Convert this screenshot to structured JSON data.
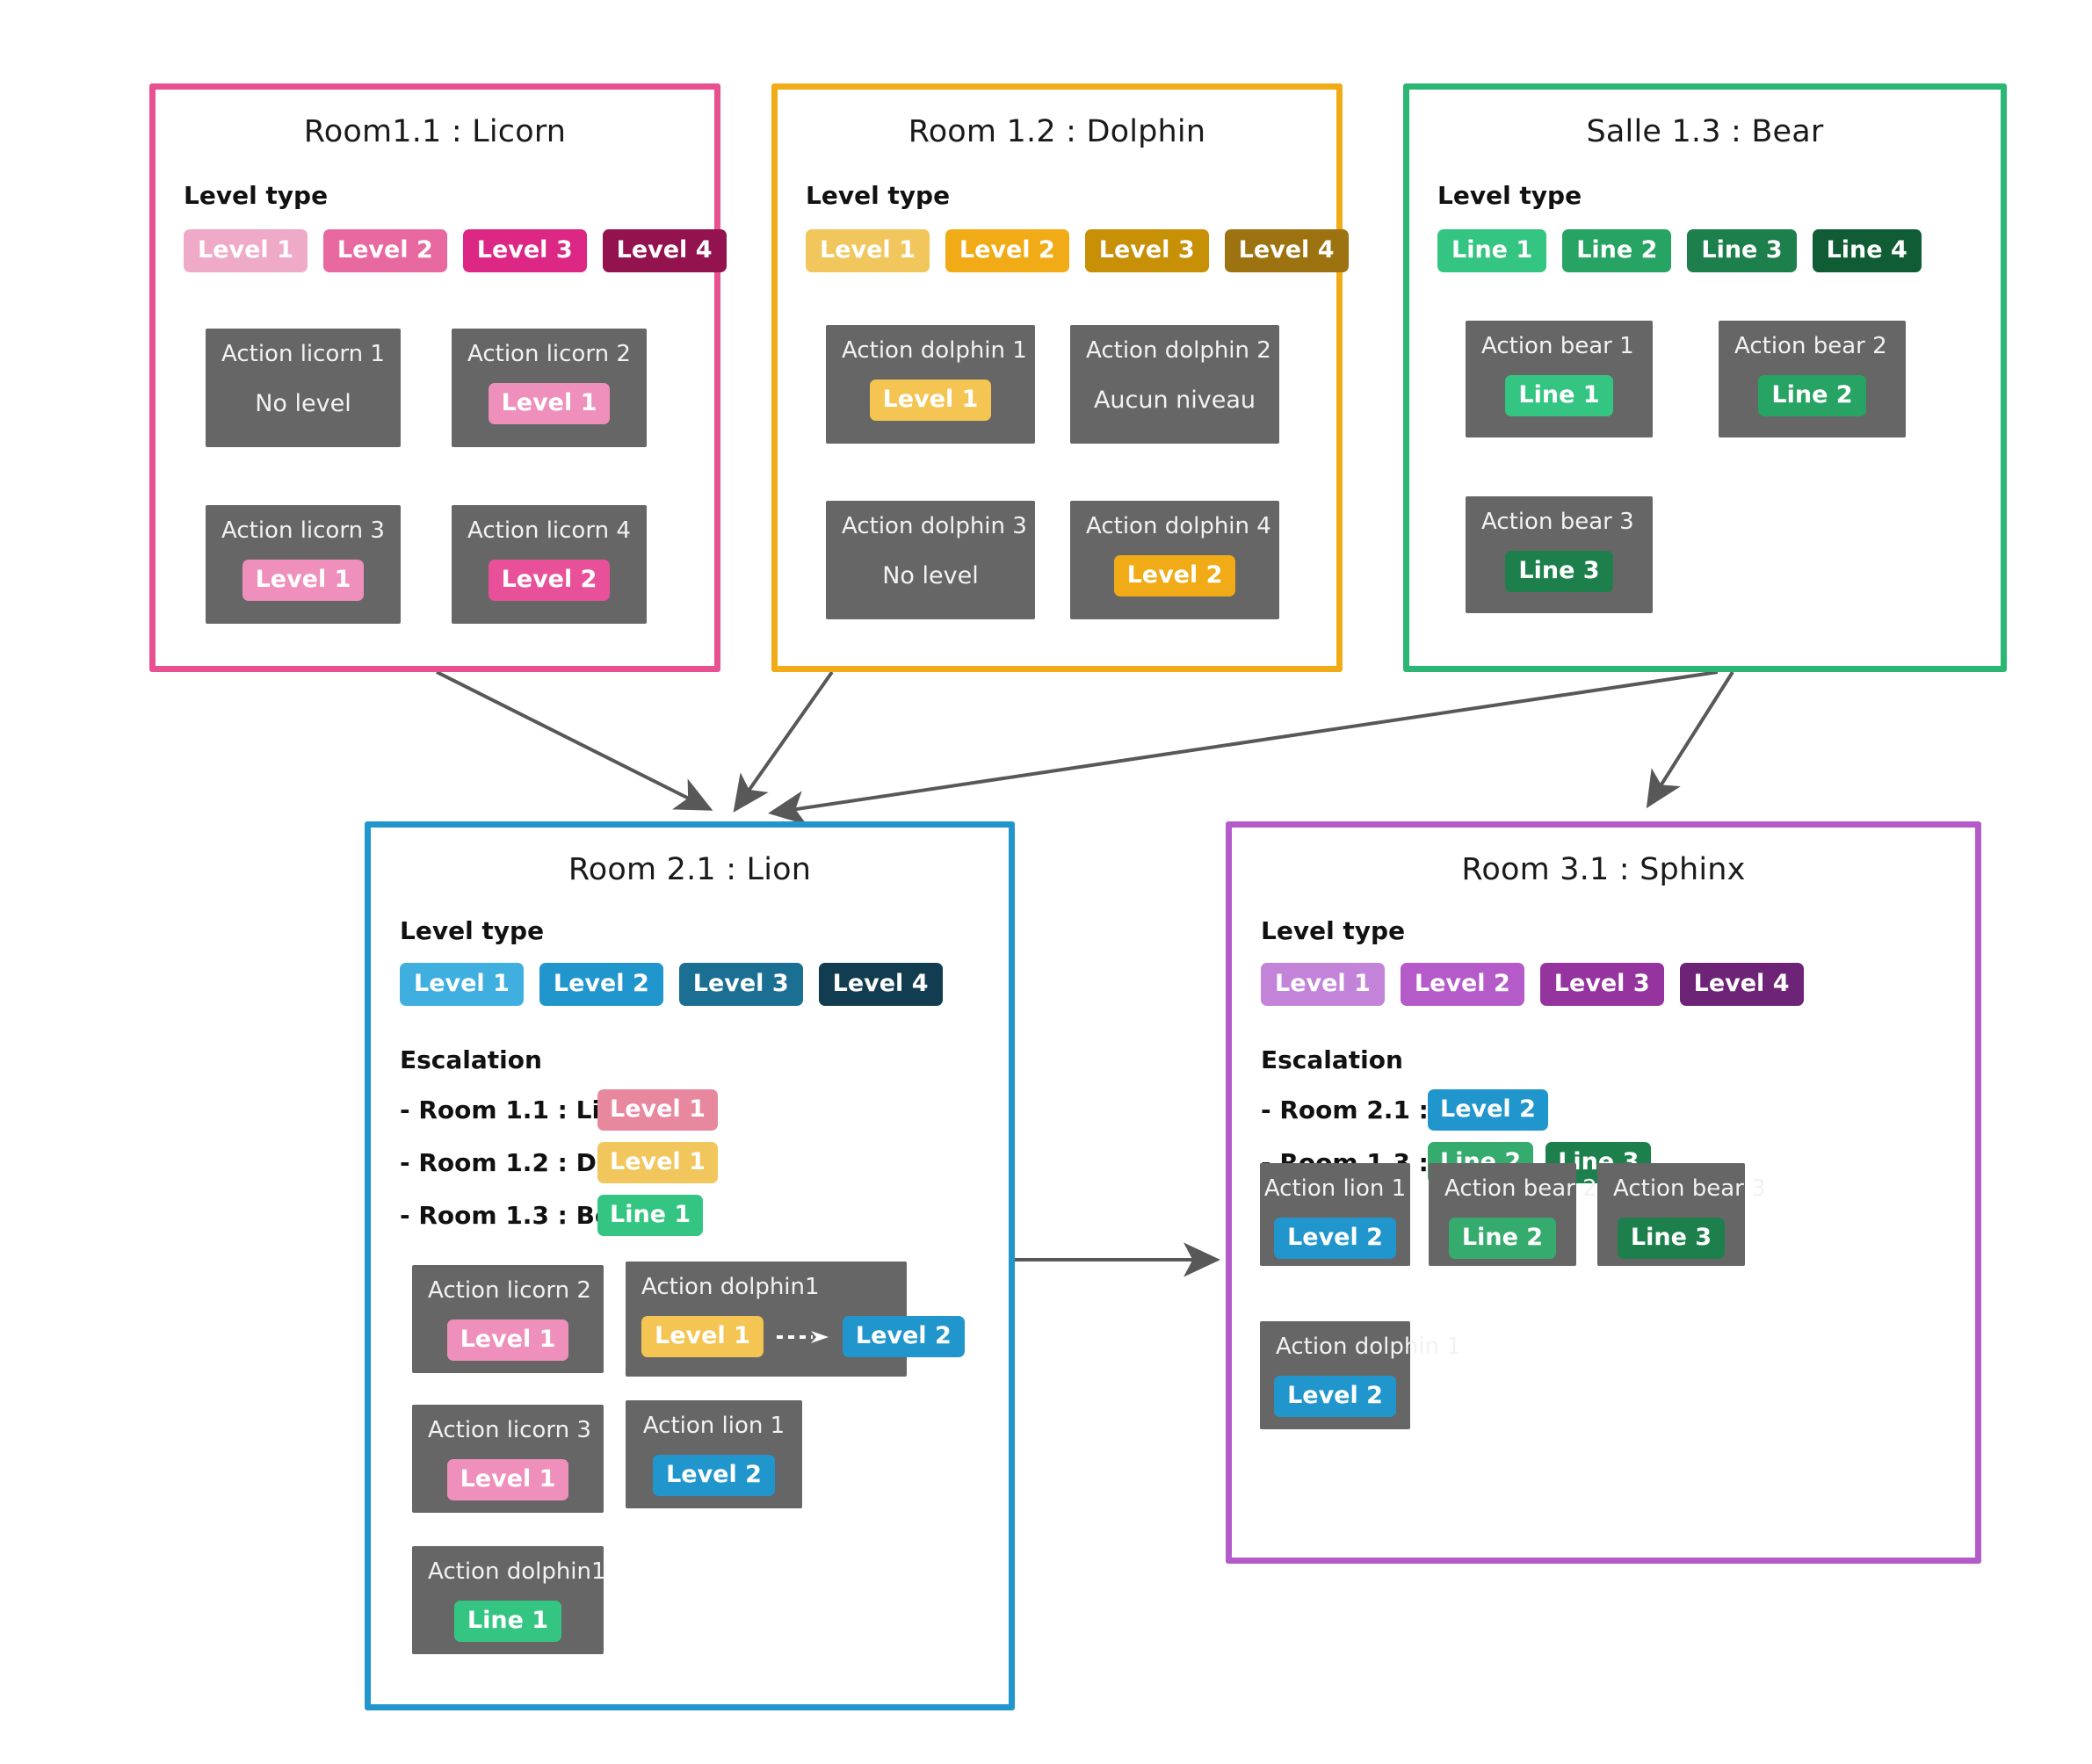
{
  "diagram": {
    "section_labels": {
      "level_type": "Level type",
      "escalation": "Escalation"
    },
    "no_level_en": "No level",
    "no_level_fr": "Aucun niveau"
  },
  "colors": {
    "licorn_border": "#e8518f",
    "dolphin_border": "#f0ab16",
    "bear_border": "#2bb673",
    "lion_border": "#2196cd",
    "sphinx_border": "#b45bc9",
    "action_bg": "#666666",
    "arrow": "#585858",
    "pink_1": "#eeaac6",
    "pink_2": "#e8699f",
    "pink_3": "#dc2784",
    "pink_4": "#93134f",
    "pink_escal": "#e8889f",
    "pink_action": "#ef8fbb",
    "amber_1": "#f1c65c",
    "amber_2": "#f0ab16",
    "amber_3": "#c79007",
    "amber_4": "#9c7310",
    "green_1": "#35c583",
    "green_2": "#27a463",
    "green_3": "#1d804c",
    "green_4": "#0f5c35",
    "blue_1": "#3fafdf",
    "blue_2": "#2196cd",
    "blue_3": "#1a6f92",
    "blue_4": "#123c50",
    "purple_1": "#c383d9",
    "purple_2": "#b45bc9",
    "purple_3": "#95349f",
    "purple_4": "#6d2476"
  },
  "rooms": {
    "licorn": {
      "title": "Room1.1 : Licorn",
      "level_type": [
        {
          "label": "Level 1",
          "color": "#eeaac6"
        },
        {
          "label": "Level 2",
          "color": "#e8699f"
        },
        {
          "label": "Level 3",
          "color": "#dc2784"
        },
        {
          "label": "Level 4",
          "color": "#93134f"
        }
      ],
      "actions": [
        {
          "title": "Action licorn  1",
          "no_level": "No level",
          "badge": null
        },
        {
          "title": "Action licorn 2",
          "badge": {
            "label": "Level 1",
            "color": "#ef8fbb"
          }
        },
        {
          "title": "Action licorn 3",
          "badge": {
            "label": "Level 1",
            "color": "#ef8fbb"
          }
        },
        {
          "title": "Action licorn 4",
          "badge": {
            "label": "Level 2",
            "color": "#e8519a"
          }
        }
      ]
    },
    "dolphin": {
      "title": "Room 1.2 : Dolphin",
      "level_type": [
        {
          "label": "Level 1",
          "color": "#f1c65c"
        },
        {
          "label": "Level 2",
          "color": "#f0ab16"
        },
        {
          "label": "Level 3",
          "color": "#c79007"
        },
        {
          "label": "Level 4",
          "color": "#9c7310"
        }
      ],
      "actions": [
        {
          "title": "Action dolphin 1",
          "badge": {
            "label": "Level 1",
            "color": "#f4c552"
          }
        },
        {
          "title": "Action dolphin 2",
          "no_level": "Aucun niveau",
          "badge": null
        },
        {
          "title": "Action dolphin 3",
          "no_level": "No level",
          "badge": null
        },
        {
          "title": "Action dolphin 4",
          "badge": {
            "label": "Level 2",
            "color": "#f0ab16"
          }
        }
      ]
    },
    "bear": {
      "title": "Salle 1.3 : Bear",
      "level_type": [
        {
          "label": "Line 1",
          "color": "#35c583"
        },
        {
          "label": "Line 2",
          "color": "#27a463"
        },
        {
          "label": "Line 3",
          "color": "#1d804c"
        },
        {
          "label": "Line 4",
          "color": "#0f5c35"
        }
      ],
      "actions": [
        {
          "title": "Action bear 1",
          "badge": {
            "label": "Line 1",
            "color": "#35c583"
          }
        },
        {
          "title": "Action bear 2",
          "badge": {
            "label": "Line 2",
            "color": "#27a463"
          }
        },
        {
          "title": "Action bear 3",
          "badge": {
            "label": "Line 3",
            "color": "#1d804c"
          }
        }
      ]
    },
    "lion": {
      "title": "Room 2.1 : Lion",
      "level_type": [
        {
          "label": "Level 1",
          "color": "#3fafdf"
        },
        {
          "label": "Level 2",
          "color": "#2196cd"
        },
        {
          "label": "Level 3",
          "color": "#1a6f92"
        },
        {
          "label": "Level 4",
          "color": "#123c50"
        }
      ],
      "escalation": [
        {
          "label": "- Room 1.1 : Licorn",
          "badges": [
            {
              "label": "Level 1",
              "color": "#e8889f"
            }
          ]
        },
        {
          "label": "- Room 1.2 : Dolphin",
          "badges": [
            {
              "label": "Level 1",
              "color": "#f1c65c"
            }
          ]
        },
        {
          "label": "- Room 1.3 : Bear",
          "badges": [
            {
              "label": "Line 1",
              "color": "#35c583"
            }
          ]
        }
      ],
      "actions": [
        {
          "title": "Action licorn 2",
          "badge": {
            "label": "Level 1",
            "color": "#ef8fbb"
          }
        },
        {
          "title": "Action dolphin1",
          "badge": {
            "label": "Level 1",
            "color": "#f4c552"
          },
          "badge2": {
            "label": "Level 2",
            "color": "#2196cd"
          }
        },
        {
          "title": "Action licorn 3",
          "badge": {
            "label": "Level 1",
            "color": "#ef8fbb"
          }
        },
        {
          "title": "Action lion 1",
          "badge": {
            "label": "Level 2",
            "color": "#2196cd"
          }
        },
        {
          "title": "Action dolphin1",
          "badge": {
            "label": "Line 1",
            "color": "#35c583"
          }
        }
      ]
    },
    "sphinx": {
      "title": "Room 3.1 : Sphinx",
      "level_type": [
        {
          "label": "Level 1",
          "color": "#c383d9"
        },
        {
          "label": "Level 2",
          "color": "#b45bc9"
        },
        {
          "label": "Level 3",
          "color": "#95349f"
        },
        {
          "label": "Level 4",
          "color": "#6d2476"
        }
      ],
      "escalation": [
        {
          "label": "- Room 2.1 : Lion",
          "badges": [
            {
              "label": "Level 2",
              "color": "#2196cd"
            }
          ]
        },
        {
          "label": "- Room 1.3 : Bear",
          "badges": [
            {
              "label": "Line 2",
              "color": "#35ab6d"
            },
            {
              "label": "Line 3",
              "color": "#1d804c"
            }
          ]
        }
      ],
      "actions": [
        {
          "title": "Action lion 1",
          "badge": {
            "label": "Level 2",
            "color": "#2196cd"
          }
        },
        {
          "title": "Action bear 2",
          "badge": {
            "label": "Line 2",
            "color": "#35ab6d"
          }
        },
        {
          "title": "Action bear 3",
          "badge": {
            "label": "Line 3",
            "color": "#1d804c"
          }
        },
        {
          "title": "Action dolphin 1",
          "badge": {
            "label": "Level 2",
            "color": "#2196cd"
          }
        }
      ]
    }
  },
  "arrows": [
    {
      "from": "licorn",
      "to": "lion"
    },
    {
      "from": "dolphin",
      "to": "lion"
    },
    {
      "from": "bear",
      "to": "lion"
    },
    {
      "from": "bear",
      "to": "sphinx"
    },
    {
      "from": "lion",
      "to": "sphinx"
    }
  ]
}
